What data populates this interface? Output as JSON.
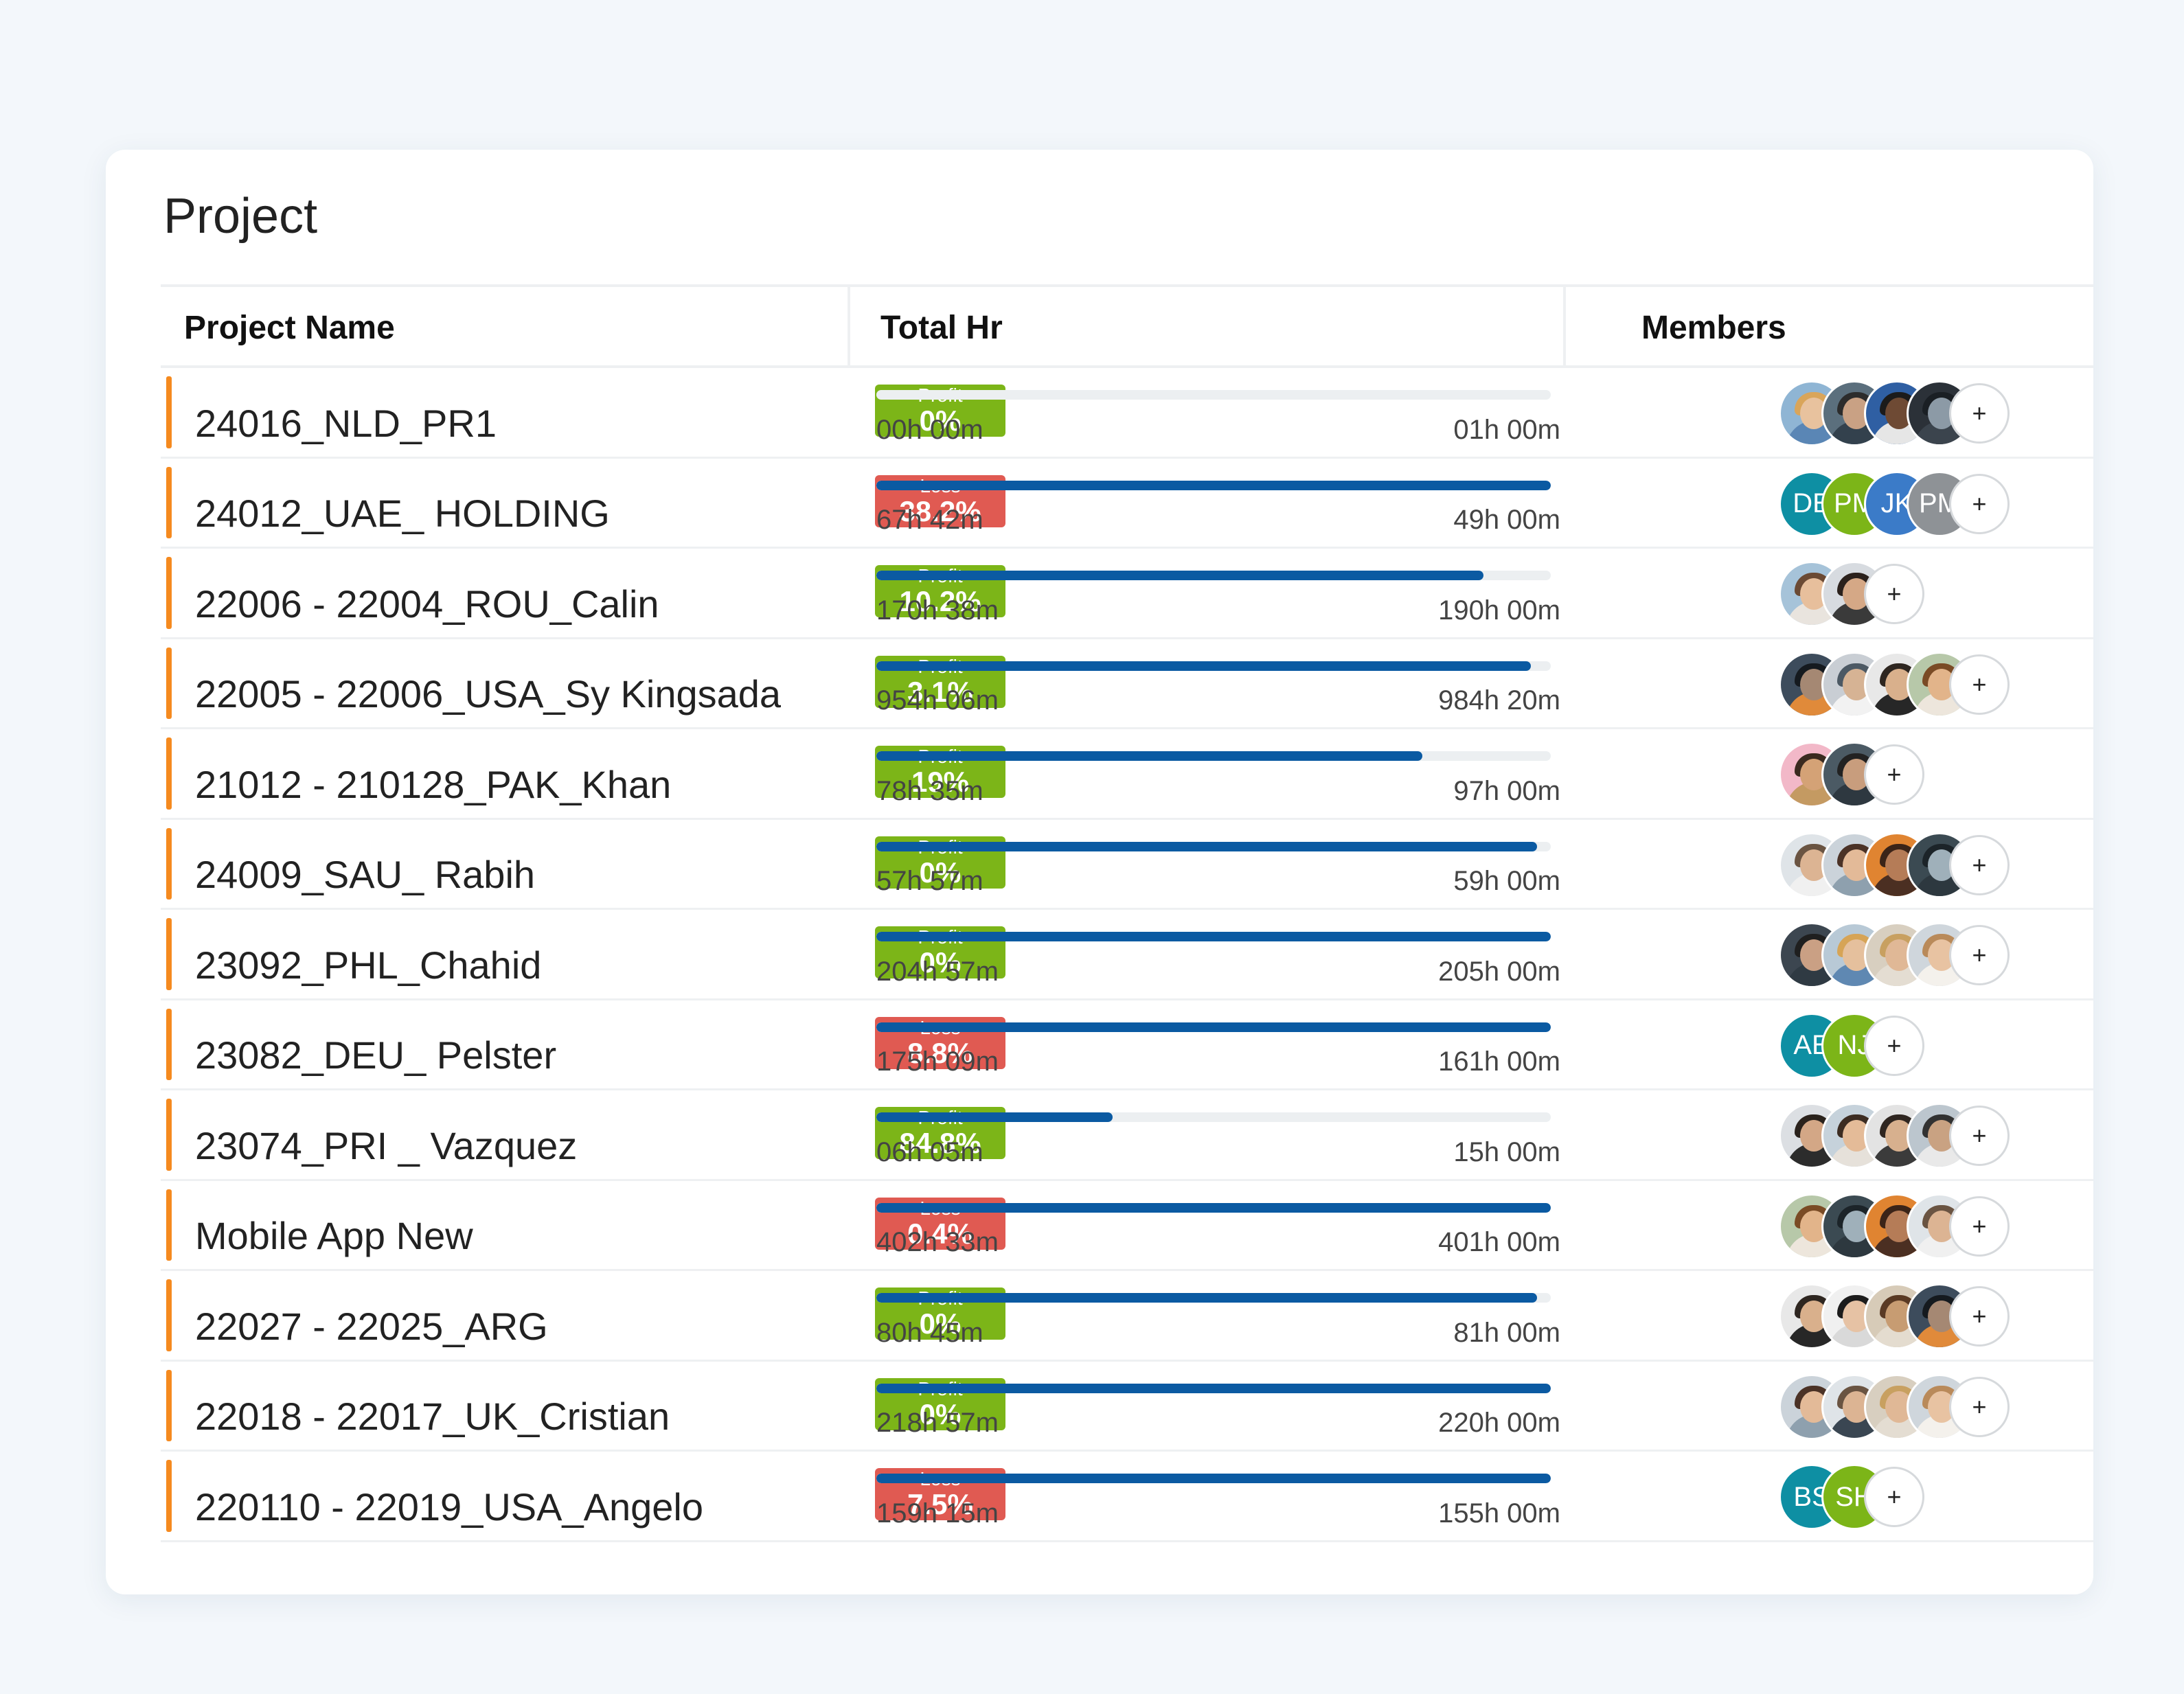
{
  "title": "Project",
  "headers": {
    "name": "Project Name",
    "hours": "Total Hr",
    "members": "Members"
  },
  "add_label": "+",
  "colors": {
    "accent": "#f58a1f",
    "profit": "#7cb518",
    "loss": "#e05a52",
    "bar": "#0b5aa2"
  },
  "rows": [
    {
      "name": "24016_NLD_PR1",
      "status": "Profit",
      "pct": "0%",
      "logged": "00h 00m",
      "estimated": "01h 00m",
      "progress": 0.0,
      "members": [
        {
          "type": "photo",
          "bg": "#8fb5d4",
          "skin": "#e8c29e",
          "hair": "#d9a55a",
          "shirt": "#5a86b5"
        },
        {
          "type": "photo",
          "bg": "#5b6f7d",
          "skin": "#c9a184",
          "hair": "#2c2c2c",
          "shirt": "#33414d"
        },
        {
          "type": "photo",
          "bg": "#2f5fa3",
          "skin": "#6e4a34",
          "hair": "#1b1b1b",
          "shirt": "#e6e6e6"
        },
        {
          "type": "photo",
          "bg": "#2b3138",
          "skin": "#8c9aa6",
          "hair": "#1a1f24",
          "shirt": "#3b444d"
        }
      ]
    },
    {
      "name": "24012_UAE_ HOLDING",
      "status": "Loss",
      "pct": "38.2%",
      "logged": "67h 42m",
      "estimated": "49h 00m",
      "progress": 1.0,
      "members": [
        {
          "type": "initials",
          "text": "DE",
          "bg": "#0e8fa3"
        },
        {
          "type": "initials",
          "text": "PM",
          "bg": "#7cb518"
        },
        {
          "type": "initials",
          "text": "JK",
          "bg": "#3b7bc8"
        },
        {
          "type": "initials",
          "text": "PM",
          "bg": "#8e9296"
        }
      ]
    },
    {
      "name": "22006 - 22004_ROU_Calin",
      "status": "Profit",
      "pct": "10.2%",
      "logged": "170h 38m",
      "estimated": "190h 00m",
      "progress": 0.9,
      "members": [
        {
          "type": "photo",
          "bg": "#a6c3d9",
          "skin": "#e7bf9c",
          "hair": "#6b4a34",
          "shirt": "#e9e4de"
        },
        {
          "type": "photo",
          "bg": "#d7dbe0",
          "skin": "#d5a886",
          "hair": "#2b211c",
          "shirt": "#3a3a3a"
        }
      ]
    },
    {
      "name": "22005 - 22006_USA_Sy Kingsada",
      "status": "Profit",
      "pct": "3.1%",
      "logged": "954h 06m",
      "estimated": "984h 20m",
      "progress": 0.97,
      "members": [
        {
          "type": "photo",
          "bg": "#3d4c5c",
          "skin": "#a58873",
          "hair": "#151a1f",
          "shirt": "#e08a3a"
        },
        {
          "type": "photo",
          "bg": "#c9ced4",
          "skin": "#d6b394",
          "hair": "#4c5964",
          "shirt": "#f2f2f2"
        },
        {
          "type": "photo",
          "bg": "#e8e8e8",
          "skin": "#d9b08c",
          "hair": "#2e2620",
          "shirt": "#272727"
        },
        {
          "type": "photo",
          "bg": "#b7c8a9",
          "skin": "#e2b48a",
          "hair": "#7a4b25",
          "shirt": "#ede6dc"
        }
      ]
    },
    {
      "name": "21012 - 210128_PAK_Khan",
      "status": "Profit",
      "pct": "19%",
      "logged": "78h 35m",
      "estimated": "97h 00m",
      "progress": 0.81,
      "members": [
        {
          "type": "photo",
          "bg": "#f2b8c8",
          "skin": "#d4a276",
          "hair": "#3a2a1f",
          "shirt": "#c49a62"
        },
        {
          "type": "photo",
          "bg": "#4b5a64",
          "skin": "#c89d7d",
          "hair": "#222222",
          "shirt": "#2e3840"
        }
      ]
    },
    {
      "name": "24009_SAU_ Rabih",
      "status": "Profit",
      "pct": "0%",
      "logged": "57h 57m",
      "estimated": "59h 00m",
      "progress": 0.98,
      "members": [
        {
          "type": "photo",
          "bg": "#dfe4e8",
          "skin": "#dcb493",
          "hair": "#6a5442",
          "shirt": "#f0f0f0"
        },
        {
          "type": "photo",
          "bg": "#cbd3da",
          "skin": "#e3ba98",
          "hair": "#4b3226",
          "shirt": "#8ea0ae"
        },
        {
          "type": "photo",
          "bg": "#e08431",
          "skin": "#b57c57",
          "hair": "#3b2418",
          "shirt": "#4b2f22"
        },
        {
          "type": "photo",
          "bg": "#3b4a52",
          "skin": "#9fb0ba",
          "hair": "#1c2429",
          "shirt": "#2d383f"
        }
      ]
    },
    {
      "name": "23092_PHL_Chahid",
      "status": "Profit",
      "pct": "0%",
      "logged": "204h 57m",
      "estimated": "205h 00m",
      "progress": 1.0,
      "members": [
        {
          "type": "photo",
          "bg": "#3c4650",
          "skin": "#caa084",
          "hair": "#1f1f1f",
          "shirt": "#2f3a43"
        },
        {
          "type": "photo",
          "bg": "#b8c9d6",
          "skin": "#e5c09d",
          "hair": "#d6a456",
          "shirt": "#5f88b2"
        },
        {
          "type": "photo",
          "bg": "#d8cfc0",
          "skin": "#e0b896",
          "hair": "#c8a060",
          "shirt": "#e4ddd2"
        },
        {
          "type": "photo",
          "bg": "#cfd6dc",
          "skin": "#e8c3a2",
          "hair": "#b98a5a",
          "shirt": "#f4f1ec"
        }
      ]
    },
    {
      "name": "23082_DEU_ Pelster",
      "status": "Loss",
      "pct": "8.8%",
      "logged": "175h 09m",
      "estimated": "161h 00m",
      "progress": 1.0,
      "members": [
        {
          "type": "initials",
          "text": "AE",
          "bg": "#0e8fa3"
        },
        {
          "type": "initials",
          "text": "NJ",
          "bg": "#7cb518"
        }
      ]
    },
    {
      "name": "23074_PRI _ Vazquez",
      "status": "Profit",
      "pct": "84.8%",
      "logged": "06h 05m",
      "estimated": "15h 00m",
      "progress": 0.35,
      "members": [
        {
          "type": "photo",
          "bg": "#dcdfe3",
          "skin": "#d3a786",
          "hair": "#2a221c",
          "shirt": "#2c2c2c"
        },
        {
          "type": "photo",
          "bg": "#c6d2db",
          "skin": "#e4bb98",
          "hair": "#3c2c22",
          "shirt": "#e6e1da"
        },
        {
          "type": "photo",
          "bg": "#e3e3e3",
          "skin": "#d7b08e",
          "hair": "#2f2620",
          "shirt": "#3b3b3b"
        },
        {
          "type": "photo",
          "bg": "#bcc6ce",
          "skin": "#c9a282",
          "hair": "#323232",
          "shirt": "#e9e9e9"
        }
      ]
    },
    {
      "name": "Mobile App New",
      "status": "Loss",
      "pct": "0.4%",
      "logged": "402h 33m",
      "estimated": "401h 00m",
      "progress": 1.0,
      "members": [
        {
          "type": "photo",
          "bg": "#b7c8a9",
          "skin": "#e2b48a",
          "hair": "#7a4b25",
          "shirt": "#ede6dc"
        },
        {
          "type": "photo",
          "bg": "#3b4a52",
          "skin": "#9fb0ba",
          "hair": "#1c2429",
          "shirt": "#2d383f"
        },
        {
          "type": "photo",
          "bg": "#e08431",
          "skin": "#b57c57",
          "hair": "#3b2418",
          "shirt": "#4b2f22"
        },
        {
          "type": "photo",
          "bg": "#dfe4e8",
          "skin": "#dcb493",
          "hair": "#6a5442",
          "shirt": "#f0f0f0"
        }
      ]
    },
    {
      "name": "22027 - 22025_ARG",
      "status": "Profit",
      "pct": "0%",
      "logged": "80h 45m",
      "estimated": "81h 00m",
      "progress": 0.98,
      "members": [
        {
          "type": "photo",
          "bg": "#e8e8e8",
          "skin": "#d9b08c",
          "hair": "#2e2620",
          "shirt": "#272727"
        },
        {
          "type": "photo",
          "bg": "#f0f0f0",
          "skin": "#e6c2a4",
          "hair": "#1c1c1c",
          "shirt": "#d9d9d9"
        },
        {
          "type": "photo",
          "bg": "#d7cbb8",
          "skin": "#c79c72",
          "hair": "#5a3a24",
          "shirt": "#e4dccf"
        },
        {
          "type": "photo",
          "bg": "#3d4c5c",
          "skin": "#a58873",
          "hair": "#151a1f",
          "shirt": "#e08a3a"
        }
      ]
    },
    {
      "name": "22018 - 22017_UK_Cristian",
      "status": "Profit",
      "pct": "0%",
      "logged": "218h 57m",
      "estimated": "220h 00m",
      "progress": 1.0,
      "members": [
        {
          "type": "photo",
          "bg": "#cbd3da",
          "skin": "#e3ba98",
          "hair": "#4b3226",
          "shirt": "#8ea0ae"
        },
        {
          "type": "photo",
          "bg": "#dfe4e8",
          "skin": "#dcb493",
          "hair": "#6a5442",
          "shirt": "#3a4652"
        },
        {
          "type": "photo",
          "bg": "#d8cfc0",
          "skin": "#e0b896",
          "hair": "#c8a060",
          "shirt": "#e4ddd2"
        },
        {
          "type": "photo",
          "bg": "#cfd6dc",
          "skin": "#e8c3a2",
          "hair": "#b98a5a",
          "shirt": "#f4f1ec"
        }
      ]
    },
    {
      "name": "220110 - 22019_USA_Angelo",
      "status": "Loss",
      "pct": "7.5%",
      "logged": "159h 15m",
      "estimated": "155h 00m",
      "progress": 1.0,
      "members": [
        {
          "type": "initials",
          "text": "BS",
          "bg": "#0e8fa3"
        },
        {
          "type": "initials",
          "text": "SH",
          "bg": "#7cb518"
        }
      ]
    }
  ]
}
